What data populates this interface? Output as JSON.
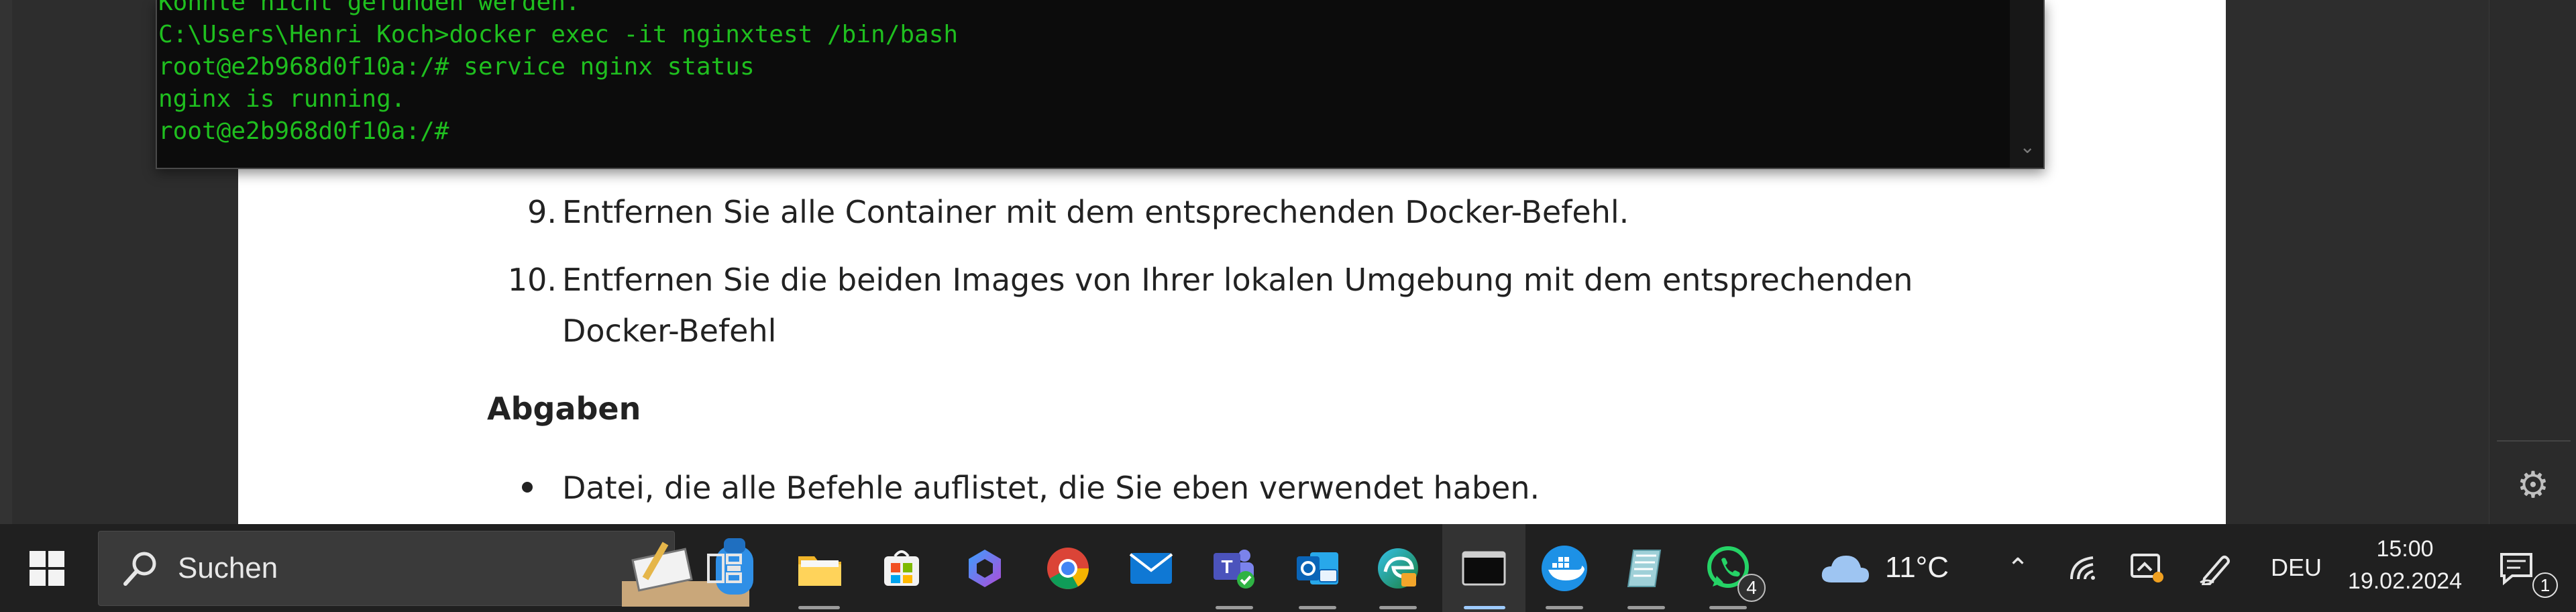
{
  "terminal": {
    "lines": [
      "Konnte nicht gefunden werden.",
      "",
      "C:\\Users\\Henri Koch>docker exec -it nginxtest /bin/bash",
      "root@e2b968d0f10a:/# service nginx status",
      "nginx is running.",
      "root@e2b968d0f10a:/#"
    ]
  },
  "document": {
    "items": [
      {
        "number": "9.",
        "text": "Entfernen Sie alle Container mit dem entsprechenden Docker-Befehl."
      },
      {
        "number": "10.",
        "text": "Entfernen Sie die beiden Images von Ihrer lokalen Umgebung mit dem entsprechenden",
        "continuation": "Docker-Befehl"
      }
    ],
    "heading": "Abgaben",
    "bullets": [
      "Datei, die alle Befehle auflistet, die Sie eben verwendet haben."
    ]
  },
  "taskbar": {
    "search_label": "Suchen",
    "weather_temp": "11°C",
    "language": "DEU",
    "time": "15:00",
    "date": "19.02.2024",
    "notification_count": "1",
    "whatsapp_badge": "4",
    "apps": [
      "task-view",
      "file-explorer",
      "microsoft-store",
      "copilot",
      "chrome",
      "mail",
      "teams",
      "outlook",
      "edge",
      "terminal",
      "docker",
      "notepad",
      "whatsapp"
    ]
  },
  "colors": {
    "terminal_text": "#1fbf1f",
    "taskbar_bg": "#202020",
    "doc_bg": "#ffffff"
  }
}
